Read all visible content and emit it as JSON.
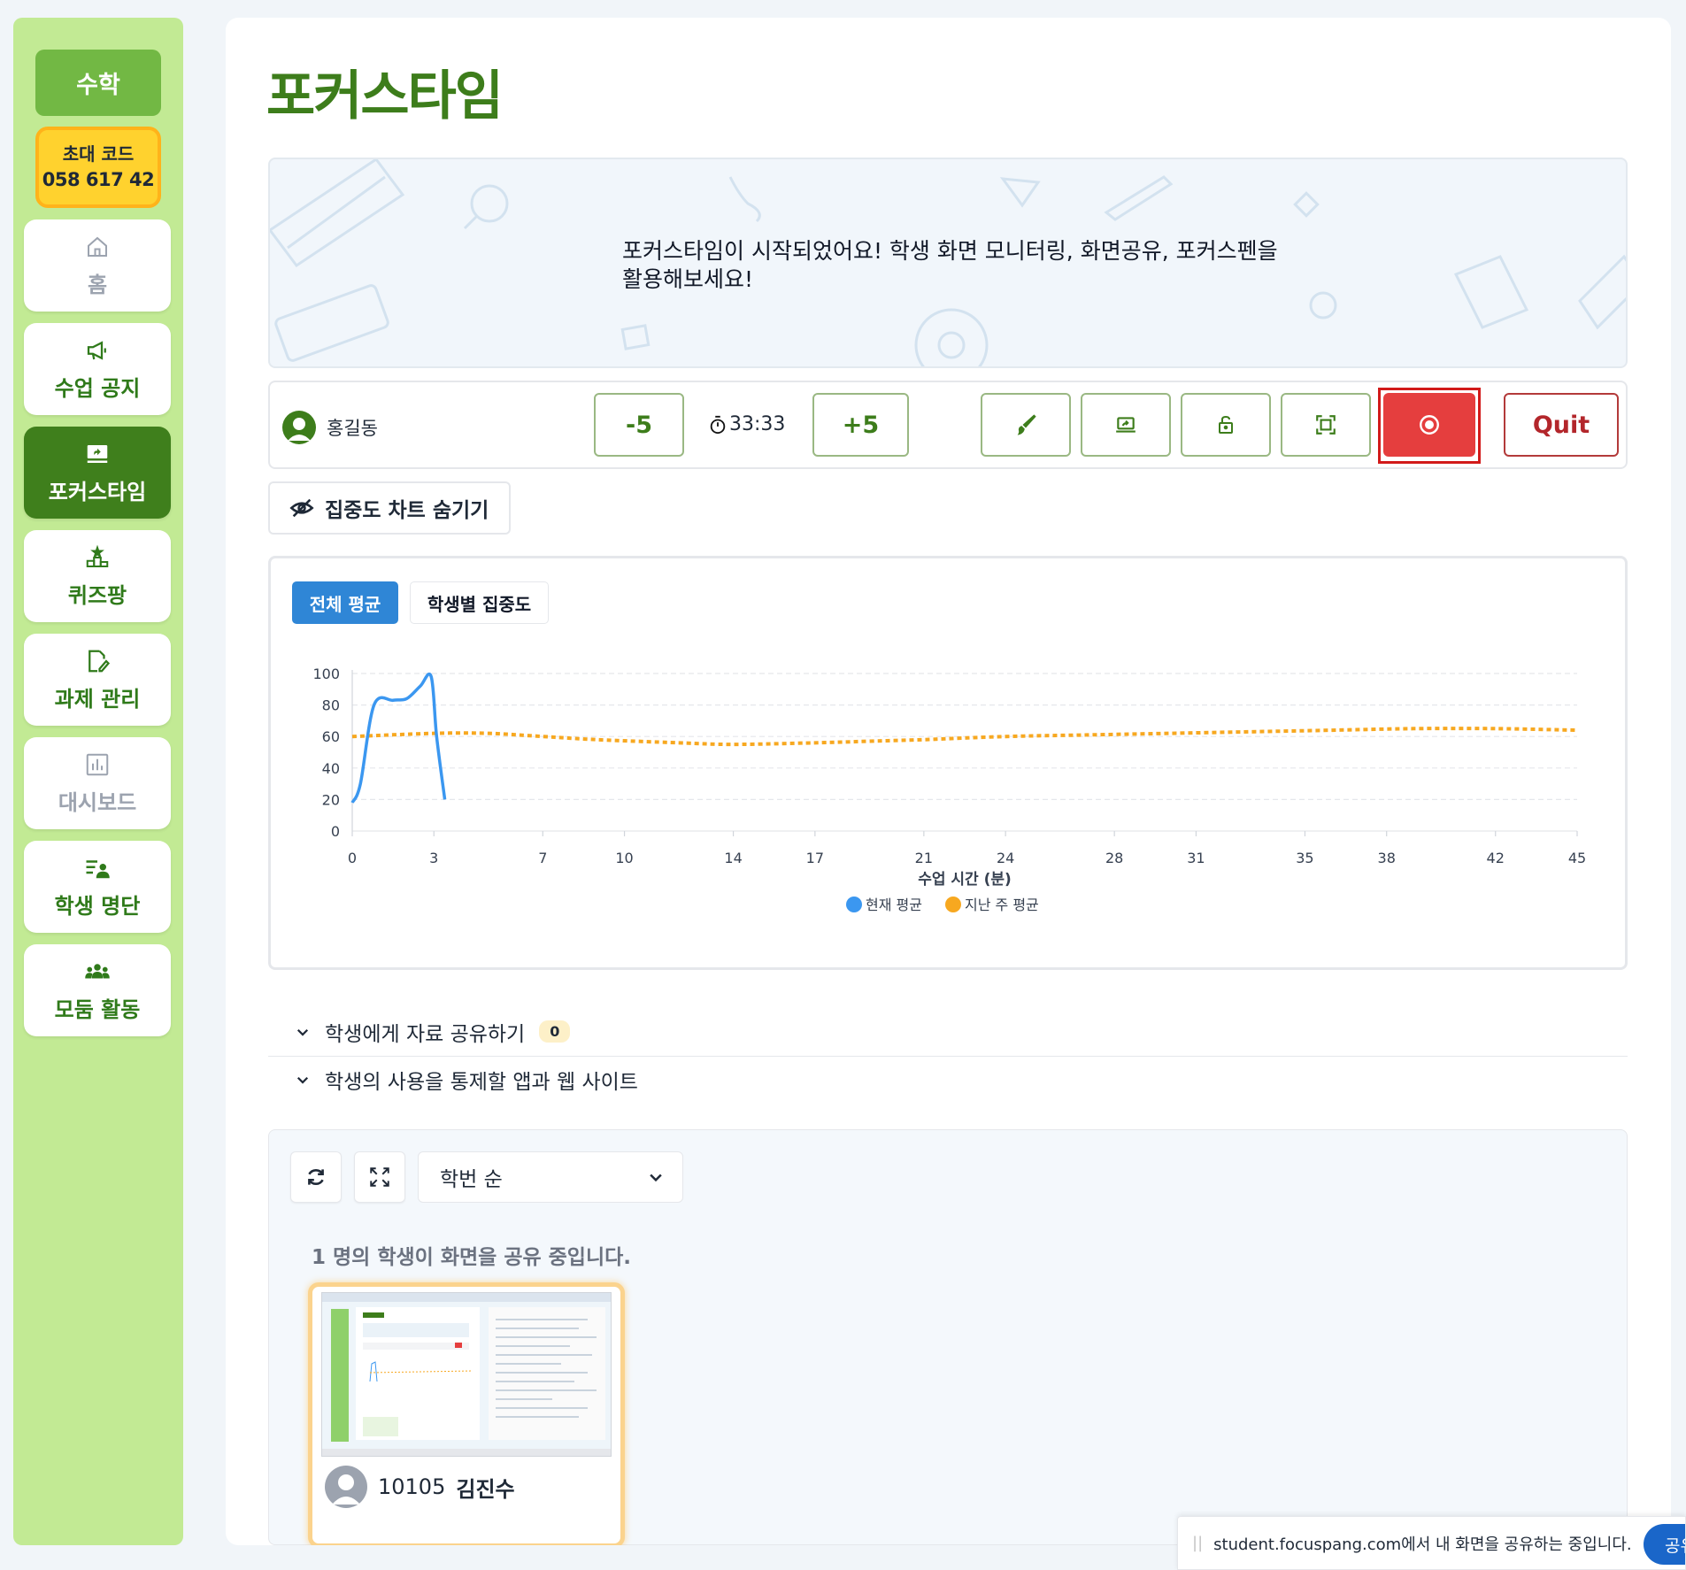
{
  "sidebar": {
    "subject": "수학",
    "invite": {
      "label": "초대 코드",
      "code": "058 617 42"
    },
    "items": [
      {
        "label": "홈",
        "icon": "home-icon"
      },
      {
        "label": "수업 공지",
        "icon": "megaphone-icon"
      },
      {
        "label": "포커스타임",
        "icon": "screen-share-icon"
      },
      {
        "label": "퀴즈팡",
        "icon": "podium-icon"
      },
      {
        "label": "과제 관리",
        "icon": "edit-doc-icon"
      },
      {
        "label": "대시보드",
        "icon": "bar-chart-icon"
      },
      {
        "label": "학생 명단",
        "icon": "roster-icon"
      },
      {
        "label": "모둠 활동",
        "icon": "group-icon"
      }
    ]
  },
  "page": {
    "title": "포커스타임"
  },
  "banner": {
    "text": "포커스타임이 시작되었어요! 학생 화면 모니터링, 화면공유, 포커스펜을 활용해보세요!"
  },
  "controls": {
    "user": "홍길동",
    "minus": "-5",
    "timer": "33:33",
    "plus": "+5",
    "tools": [
      "brush-icon",
      "screen-share-icon",
      "lock-icon",
      "fullscreen-icon",
      "target-icon"
    ],
    "quit": "Quit"
  },
  "hide_chart": "집중도 차트 숨기기",
  "chart_tabs": {
    "active": "전체 평균",
    "other": "학생별 집중도"
  },
  "chart_data": {
    "type": "line",
    "xlabel": "수업 시간 (분)",
    "ylabel": "",
    "xlim": [
      0,
      45
    ],
    "ylim": [
      0,
      100
    ],
    "x_ticks": [
      0,
      3,
      7,
      10,
      14,
      17,
      21,
      24,
      28,
      31,
      35,
      38,
      42,
      45
    ],
    "y_ticks": [
      0,
      20,
      40,
      60,
      80,
      100
    ],
    "grid": true,
    "legend": "bottom",
    "series": [
      {
        "name": "현재 평균",
        "color": "#3b97f0",
        "style": "solid",
        "x": [
          0,
          0.3,
          0.8,
          1.5,
          2.0,
          2.5,
          2.9,
          3.1,
          3.4
        ],
        "y": [
          18,
          30,
          80,
          83,
          84,
          92,
          98,
          60,
          20
        ]
      },
      {
        "name": "지난 주 평균",
        "color": "#f7a820",
        "style": "dashed",
        "x": [
          0,
          3,
          5,
          7,
          9,
          12,
          14,
          17,
          19,
          21,
          24,
          27,
          30,
          33,
          36,
          39,
          42,
          45
        ],
        "y": [
          60,
          62,
          62,
          60,
          58,
          56,
          55,
          56,
          57,
          58,
          60,
          61,
          62,
          63,
          64,
          65,
          65,
          64
        ]
      }
    ]
  },
  "accordions": [
    {
      "label": "학생에게 자료 공유하기",
      "count": "0"
    },
    {
      "label": "학생의 사용을 통제할 앱과 웹 사이트"
    }
  ],
  "share": {
    "sort": "학번 순",
    "info": "1 명의 학생이 화면을 공유 중입니다.",
    "students": [
      {
        "id": "10105",
        "name": "김진수"
      }
    ]
  },
  "notification": {
    "text": "student.focuspang.com에서 내 화면을 공유하는 중입니다.",
    "button": "공유"
  },
  "colors": {
    "brand_green": "#3d7d1b",
    "sidebar_bg": "#c2ea94",
    "accent_blue": "#2f86d6",
    "danger": "#e53e3e"
  }
}
